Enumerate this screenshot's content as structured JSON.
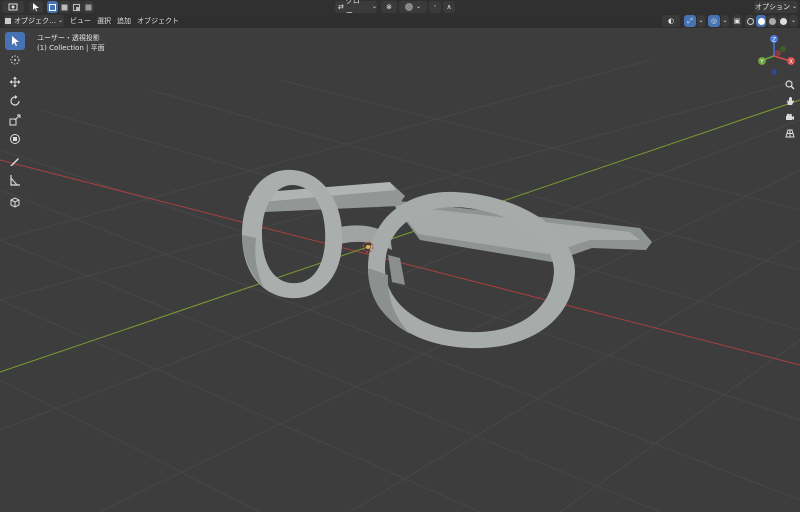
{
  "topbar": {
    "mode_icon": "select-box-icon",
    "transform_orientation": "グロー…",
    "options_label": "オプション"
  },
  "header": {
    "mode_dropdown": "オブジェク…",
    "menus": [
      "ビュー",
      "選択",
      "追加",
      "オブジェクト"
    ]
  },
  "viewport": {
    "view_name": "ユーザー・透視投影",
    "collection_info": "(1) Collection | 平面"
  },
  "gizmo": {
    "x_label": "X",
    "y_label": "Y",
    "z_label": "Z"
  },
  "colors": {
    "background": "#3d3d3d",
    "grid": "#484848",
    "x_axis": "#a8403f",
    "y_axis": "#7a9d31",
    "active_tool": "#4772b3",
    "model": "#a9adab"
  }
}
